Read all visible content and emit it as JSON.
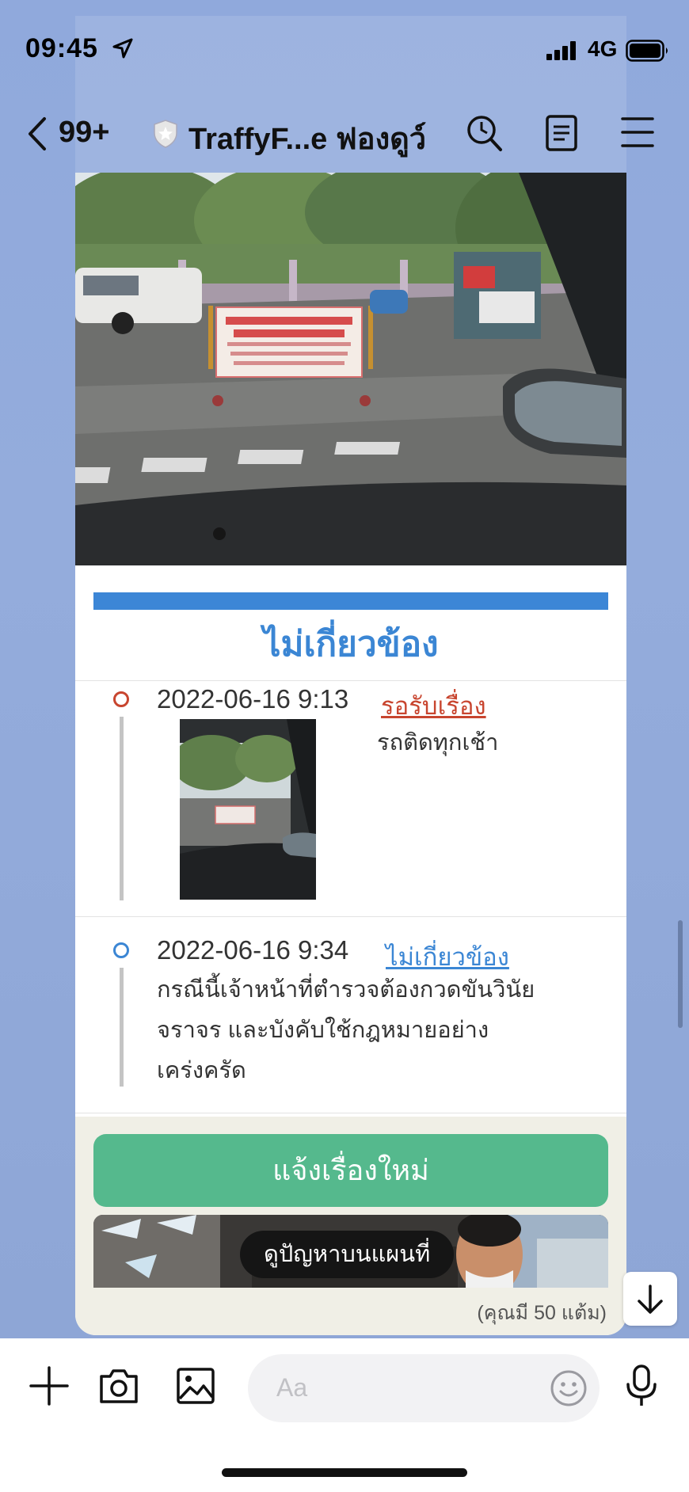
{
  "status_bar": {
    "time": "09:45",
    "network": "4G",
    "icons": [
      "location-arrow-icon",
      "signal-bars-icon",
      "battery-icon"
    ]
  },
  "header": {
    "unread_count": "99+",
    "chat_title": "TraffyF...e ฟองดูว์",
    "icons": [
      "back-chevron-icon",
      "shield-icon",
      "search-icon",
      "notes-icon",
      "menu-icon"
    ]
  },
  "card": {
    "status_heading": "ไม่เกี่ยวข้อง",
    "timeline": [
      {
        "date": "2022-06-16 9:13",
        "status": "รอรับเรื่อง",
        "status_color": "#c8452f",
        "note": "รถติดทุกเช้า",
        "has_photo": true
      },
      {
        "date": "2022-06-16 9:34",
        "status": "ไม่เกี่ยวข้อง",
        "status_color": "#3b86d4",
        "body": "กรณีนี้เจ้าหน้าที่ตำรวจต้องกวดขันวินัยจราจร และบังคับใช้กฎหมายอย่างเคร่งครัด"
      }
    ],
    "new_report_button": "แจ้งเรื่องใหม่",
    "map_button": "ดูปัญหาบนแผนที่",
    "points_text": "(คุณมี 50 แต้ม)"
  },
  "input_bar": {
    "placeholder": "Aa",
    "icons": [
      "plus-icon",
      "camera-icon",
      "image-icon",
      "emoji-icon",
      "microphone-icon"
    ]
  },
  "colors": {
    "accent_blue": "#3b86d4",
    "pending_red": "#c8452f",
    "button_green": "#55b98d",
    "background": "#8fa7d8"
  }
}
